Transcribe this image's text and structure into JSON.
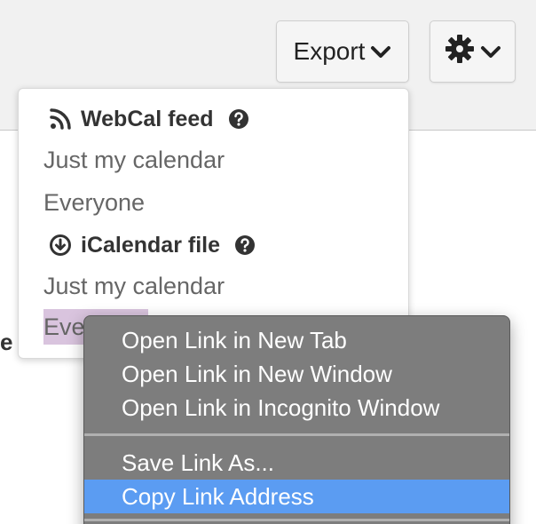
{
  "toolbar": {
    "export_label": "Export",
    "export_icon": "chevron-down-icon",
    "settings_icon": "gear-icon",
    "settings_chevron": "chevron-down-icon"
  },
  "background_fragment": "e",
  "export_menu": {
    "webcal": {
      "label": "WebCal feed",
      "icon": "rss-icon",
      "help_icon": "question-circle-icon",
      "items": [
        "Just my calendar",
        "Everyone"
      ]
    },
    "icalendar": {
      "label": "iCalendar file",
      "icon": "download-circle-icon",
      "help_icon": "question-circle-icon",
      "items": [
        "Just my calendar"
      ]
    },
    "partial_item": {
      "visible_text": "Eve",
      "highlight_color": "#d9c4de"
    }
  },
  "context_menu": {
    "items": [
      "Open Link in New Tab",
      "Open Link in New Window",
      "Open Link in Incognito Window",
      "Save Link As...",
      "Copy Link Address"
    ],
    "active_item": "Copy Link Address",
    "active_color": "#5b9cf2",
    "background_color": "#7d7d7d"
  }
}
